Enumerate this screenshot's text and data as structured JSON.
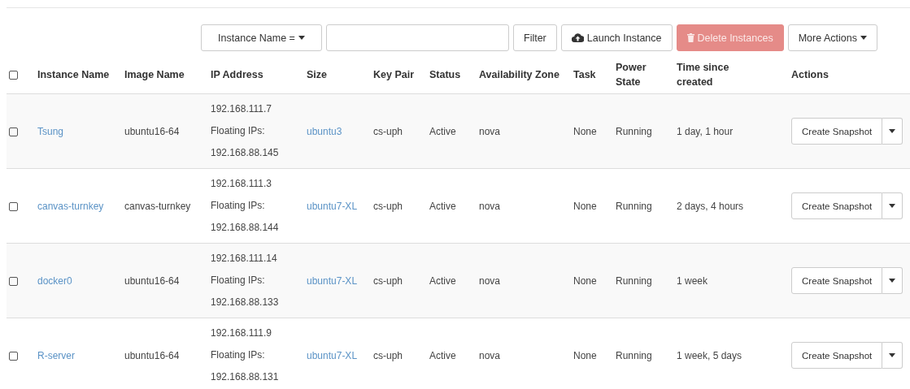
{
  "toolbar": {
    "filter_field": {
      "label": "Instance Name ="
    },
    "filter_button": "Filter",
    "launch_button": "Launch Instance",
    "delete_button": {
      "label": "Delete Instances",
      "disabled": true
    },
    "more_button": "More Actions"
  },
  "table": {
    "select_all": {
      "checked": false
    },
    "columns": [
      "Instance Name",
      "Image Name",
      "IP Address",
      "Size",
      "Key Pair",
      "Status",
      "Availability Zone",
      "Task",
      "Power State",
      "Time since created",
      "Actions"
    ],
    "rows": [
      {
        "checked": false,
        "name": "Tsung",
        "image": "ubuntu16-64",
        "ip": [
          "192.168.111.7",
          "Floating IPs:",
          "192.168.88.145"
        ],
        "size": "ubuntu3",
        "key_pair": "cs-uph",
        "status": "Active",
        "zone": "nova",
        "task": "None",
        "power_state": "Running",
        "time": "1 day, 1 hour",
        "action": "Create Snapshot"
      },
      {
        "checked": false,
        "name": "canvas-turnkey",
        "image": "canvas-turnkey",
        "ip": [
          "192.168.111.3",
          "Floating IPs:",
          "192.168.88.144"
        ],
        "size": "ubuntu7-XL",
        "key_pair": "cs-uph",
        "status": "Active",
        "zone": "nova",
        "task": "None",
        "power_state": "Running",
        "time": "2 days, 4 hours",
        "action": "Create Snapshot"
      },
      {
        "checked": false,
        "name": "docker0",
        "image": "ubuntu16-64",
        "ip": [
          "192.168.111.14",
          "Floating IPs:",
          "192.168.88.133"
        ],
        "size": "ubuntu7-XL",
        "key_pair": "cs-uph",
        "status": "Active",
        "zone": "nova",
        "task": "None",
        "power_state": "Running",
        "time": "1 week",
        "action": "Create Snapshot"
      },
      {
        "checked": false,
        "name": "R-server",
        "image": "ubuntu16-64",
        "ip": [
          "192.168.111.9",
          "Floating IPs:",
          "192.168.88.131"
        ],
        "size": "ubuntu7-XL",
        "key_pair": "cs-uph",
        "status": "Active",
        "zone": "nova",
        "task": "None",
        "power_state": "Running",
        "time": "1 week, 5 days",
        "action": "Create Snapshot"
      }
    ]
  }
}
